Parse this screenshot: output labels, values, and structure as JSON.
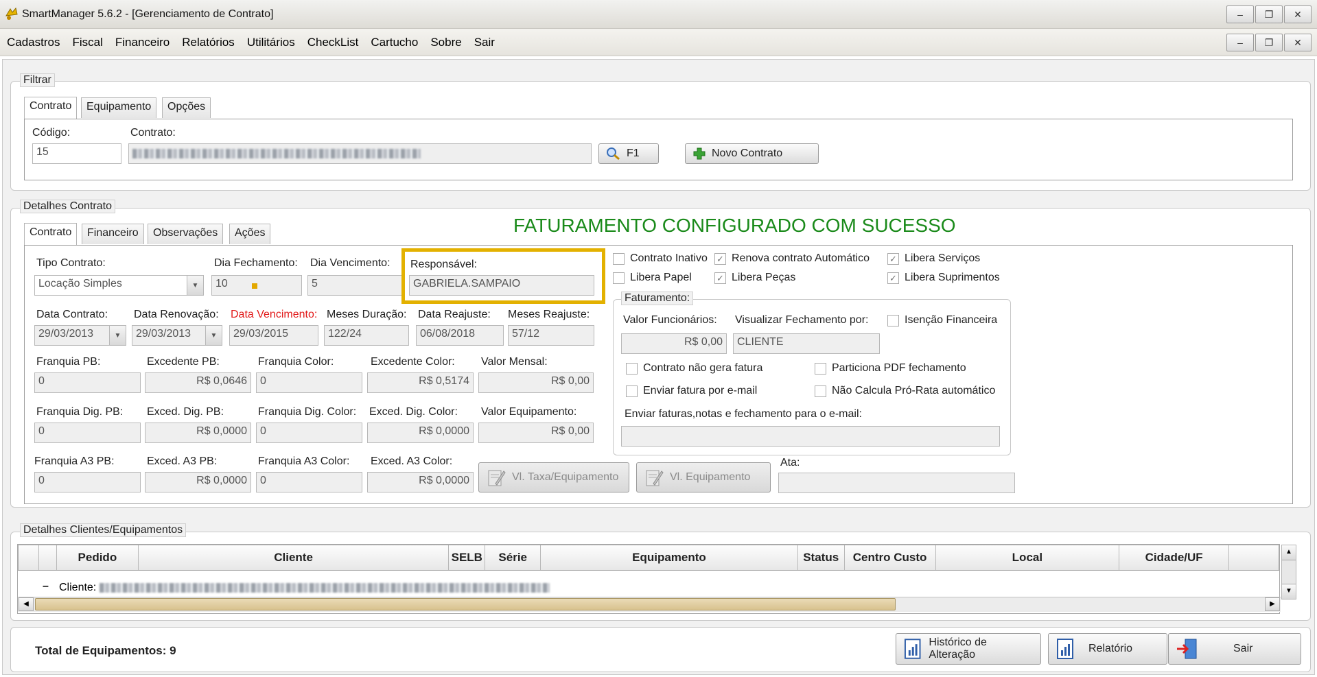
{
  "window": {
    "title": "SmartManager 5.6.2 - [Gerenciamento de Contrato]"
  },
  "menu": [
    "Cadastros",
    "Fiscal",
    "Financeiro",
    "Relatórios",
    "Utilitários",
    "CheckList",
    "Cartucho",
    "Sobre",
    "Sair"
  ],
  "filtrar": {
    "legend": "Filtrar",
    "tabs": [
      "Contrato",
      "Equipamento",
      "Opções"
    ],
    "codigo_label": "Código:",
    "codigo_value": "15",
    "contrato_label": "Contrato:",
    "search_button": "F1",
    "new_button": "Novo Contrato"
  },
  "detalhes": {
    "legend": "Detalhes Contrato",
    "tabs": [
      "Contrato",
      "Financeiro",
      "Observações",
      "Ações"
    ],
    "success_message": "FATURAMENTO CONFIGURADO COM SUCESSO",
    "success_color": "#1a8a1a",
    "tipo_label": "Tipo Contrato:",
    "tipo_value": "Locação Simples",
    "dia_fech_label": "Dia Fechamento:",
    "dia_fech_value": "10",
    "dia_venc_label": "Dia Vencimento:",
    "dia_venc_value": "5",
    "resp_label": "Responsável:",
    "resp_value": "GABRIELA.SAMPAIO",
    "highlight_color": "#e3b100",
    "data_contrato_label": "Data Contrato:",
    "data_contrato_value": "29/03/2013",
    "data_renov_label": "Data Renovação:",
    "data_renov_value": "29/03/2013",
    "data_venc_label": "Data Vencimento:",
    "data_venc_value": "29/03/2015",
    "meses_dur_label": "Meses Duração:",
    "meses_dur_value": "122/24",
    "data_reaj_label": "Data Reajuste:",
    "data_reaj_value": "06/08/2018",
    "meses_reaj_label": "Meses Reajuste:",
    "meses_reaj_value": "57/12",
    "franq_pb_label": "Franquia PB:",
    "franq_pb_value": "0",
    "exc_pb_label": "Excedente PB:",
    "exc_pb_value": "R$ 0,0646",
    "franq_color_label": "Franquia Color:",
    "franq_color_value": "0",
    "exc_color_label": "Excedente Color:",
    "exc_color_value": "R$ 0,5174",
    "valor_mensal_label": "Valor Mensal:",
    "valor_mensal_value": "R$ 0,00",
    "franq_dig_pb_label": "Franquia Dig. PB:",
    "franq_dig_pb_value": "0",
    "exc_dig_pb_label": "Exced. Dig. PB:",
    "exc_dig_pb_value": "R$ 0,0000",
    "franq_dig_color_label": "Franquia Dig. Color:",
    "franq_dig_color_value": "0",
    "exc_dig_color_label": "Exced. Dig. Color:",
    "exc_dig_color_value": "R$ 0,0000",
    "valor_equip_label": "Valor Equipamento:",
    "valor_equip_value": "R$ 0,00",
    "franq_a3_pb_label": "Franquia A3 PB:",
    "franq_a3_pb_value": "0",
    "exc_a3_pb_label": "Exced. A3 PB:",
    "exc_a3_pb_value": "R$ 0,0000",
    "franq_a3_color_label": "Franquia A3 Color:",
    "franq_a3_color_value": "0",
    "exc_a3_color_label": "Exced. A3 Color:",
    "exc_a3_color_value": "R$ 0,0000",
    "vl_taxa_button": "Vl. Taxa/Equipamento",
    "vl_equip_button": "Vl. Equipamento",
    "ata_label": "Ata:",
    "checks": {
      "contrato_inativo": "Contrato Inativo",
      "renova_auto": "Renova contrato Automático",
      "libera_servicos": "Libera Serviços",
      "libera_papel": "Libera Papel",
      "libera_pecas": "Libera Peças",
      "libera_suprimentos": "Libera Suprimentos"
    },
    "faturamento": {
      "legend": "Faturamento:",
      "valor_func_label": "Valor Funcionários:",
      "valor_func_value": "R$ 0,00",
      "visualizar_label": "Visualizar Fechamento por:",
      "visualizar_value": "CLIENTE",
      "isencao": "Isenção Financeira",
      "nao_gera": "Contrato não gera fatura",
      "particiona": "Particiona PDF fechamento",
      "enviar_email": "Enviar fatura por e-mail",
      "nao_calcula": "Não Calcula Pró-Rata automático",
      "enviar_label": "Enviar faturas,notas e fechamento para o e-mail:"
    }
  },
  "clientes": {
    "legend": "Detalhes Clientes/Equipamentos",
    "columns": [
      "Pedido",
      "Cliente",
      "SELB",
      "Série",
      "Equipamento",
      "Status",
      "Centro Custo",
      "Local",
      "Cidade/UF"
    ],
    "group_prefix": "Cliente:"
  },
  "footer": {
    "total_label": "Total de Equipamentos: 9",
    "historico_button": "Histórico de Alteração",
    "relatorio_button": "Relatório",
    "sair_button": "Sair"
  }
}
